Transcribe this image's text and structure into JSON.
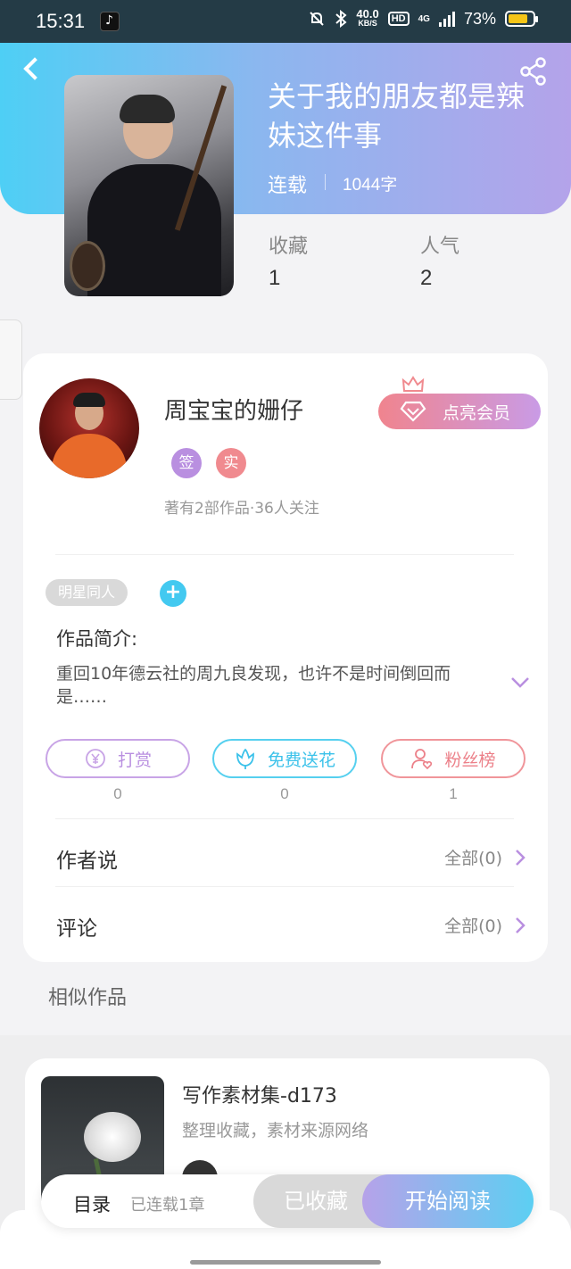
{
  "status_bar": {
    "time": "15:31",
    "net_speed_value": "40.0",
    "net_speed_unit": "KB/S",
    "hd": "HD",
    "network": "4G",
    "battery": "73%"
  },
  "header": {
    "title": "关于我的朋友都是辣妹这件事",
    "serial_status": "连载",
    "word_count": "1044字",
    "stats": [
      {
        "label": "收藏",
        "value": "1"
      },
      {
        "label": "人气",
        "value": "2"
      }
    ]
  },
  "author": {
    "name": "周宝宝的姗仔",
    "member_button": "点亮会员",
    "badges": [
      "签",
      "实"
    ],
    "meta": "著有2部作品·36人关注"
  },
  "work": {
    "tag": "明星同人",
    "add_tag": "+",
    "synopsis_title": "作品简介:",
    "synopsis_text": "重回10年德云社的周九良发现，也许不是时间倒回而是……"
  },
  "actions": [
    {
      "label": "打赏",
      "count": "0"
    },
    {
      "label": "免费送花",
      "count": "0"
    },
    {
      "label": "粉丝榜",
      "count": "1"
    }
  ],
  "rows": [
    {
      "label": "作者说",
      "value": "全部(0)"
    },
    {
      "label": "评论",
      "value": "全部(0)"
    }
  ],
  "similar": {
    "heading": "相似作品",
    "items": [
      {
        "title": "写作素材集-d173",
        "desc": "整理收藏，素材来源网络"
      }
    ]
  },
  "bottom_bar": {
    "toc": "目录",
    "chapters": "已连载1章",
    "collected": "已收藏",
    "read": "开始阅读"
  },
  "colors": {
    "header_gradient_start": "#4ecff5",
    "header_gradient_end": "#b4a3ea",
    "reward": "#b98fe0",
    "flower": "#3cc2ea",
    "fans": "#ec8089"
  }
}
